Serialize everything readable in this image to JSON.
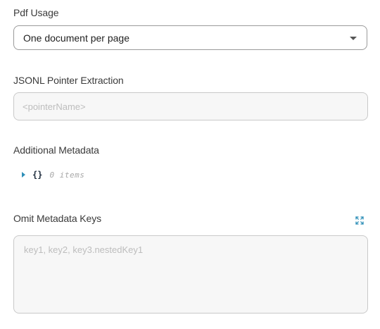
{
  "pdf_usage": {
    "label": "Pdf Usage",
    "selected": "One document per page",
    "caret_icon": "chevron-down-icon"
  },
  "jsonl_pointer": {
    "label": "JSONL Pointer Extraction",
    "placeholder": "<pointerName>",
    "value": ""
  },
  "additional_metadata": {
    "label": "Additional Metadata",
    "toggle_icon": "caret-right-icon",
    "braces": "{}",
    "count": "0 items"
  },
  "omit_metadata_keys": {
    "label": "Omit Metadata Keys",
    "expand_icon": "expand-icon",
    "placeholder": "key1, key2, key3.nestedKey1",
    "value": ""
  },
  "colors": {
    "accent": "#2f8fb8",
    "border": "#9a9a9a",
    "input_bg": "#f7f7f7"
  }
}
